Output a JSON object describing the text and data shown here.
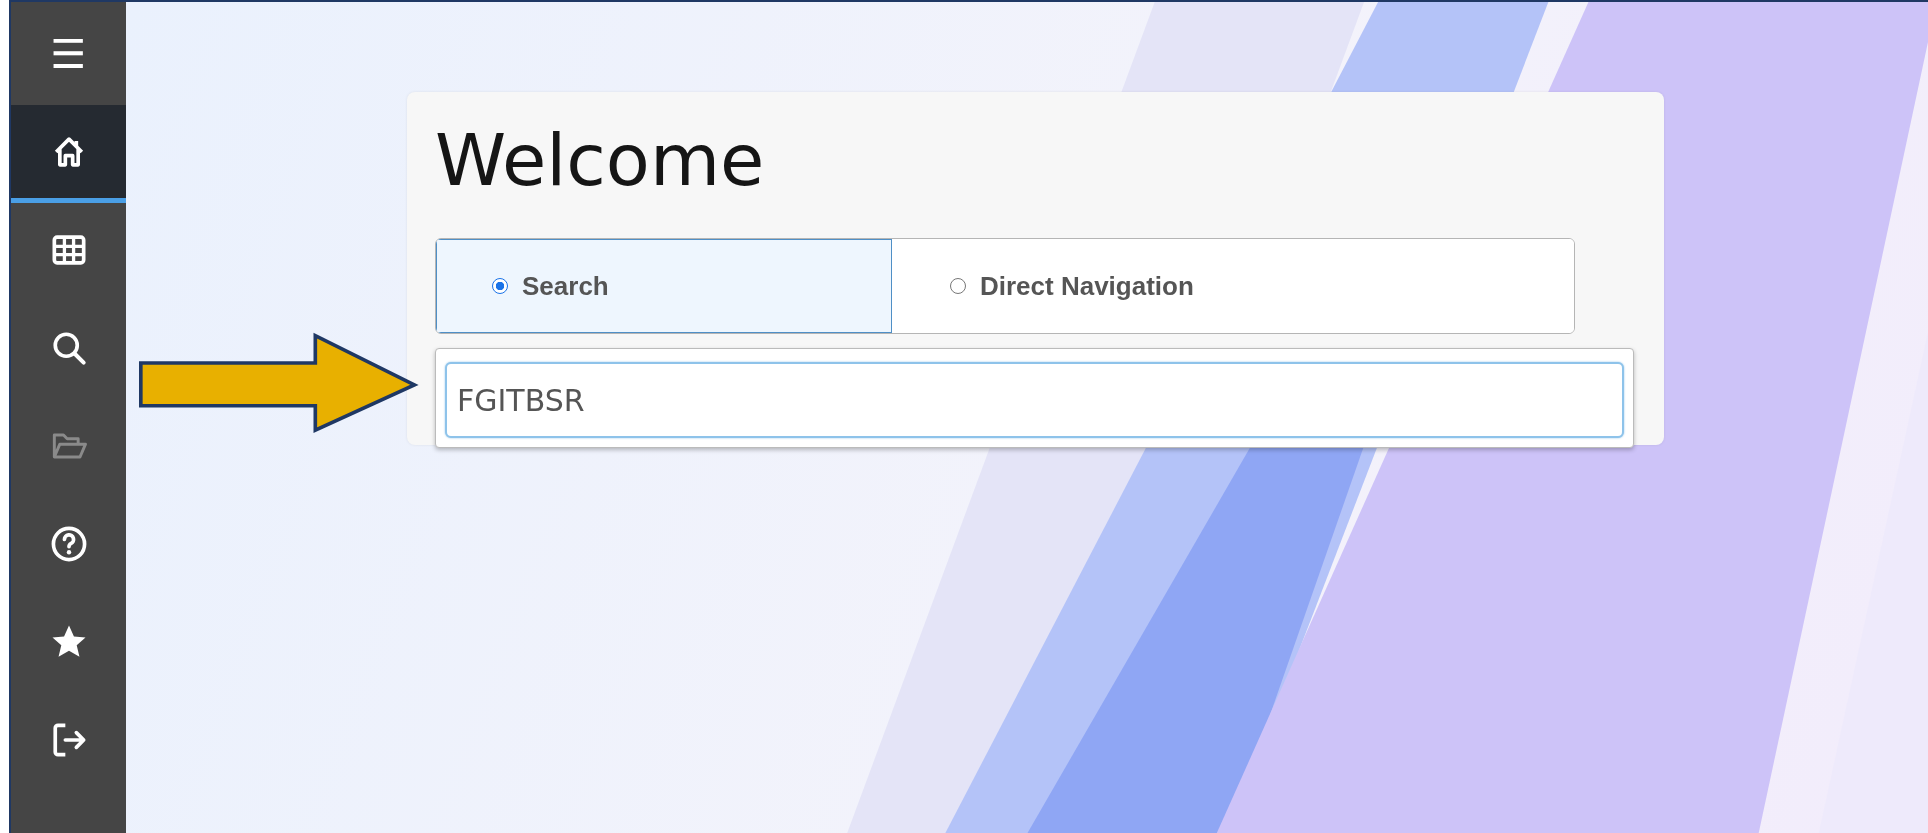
{
  "sidebar": {
    "menu_button": {
      "label": "☰"
    },
    "items": [
      {
        "selected": true,
        "disabled": false
      },
      {
        "selected": false,
        "disabled": false
      },
      {
        "selected": false,
        "disabled": false
      },
      {
        "selected": false,
        "disabled": true
      },
      {
        "selected": false,
        "disabled": false
      },
      {
        "selected": false,
        "disabled": false
      },
      {
        "selected": false,
        "disabled": false
      }
    ]
  },
  "card": {
    "title": "Welcome",
    "tabs": [
      {
        "label": "Search",
        "selected": true
      },
      {
        "label": "Direct Navigation",
        "selected": false
      }
    ],
    "search_field": {
      "value": "FGITBSR",
      "focused": true
    }
  }
}
